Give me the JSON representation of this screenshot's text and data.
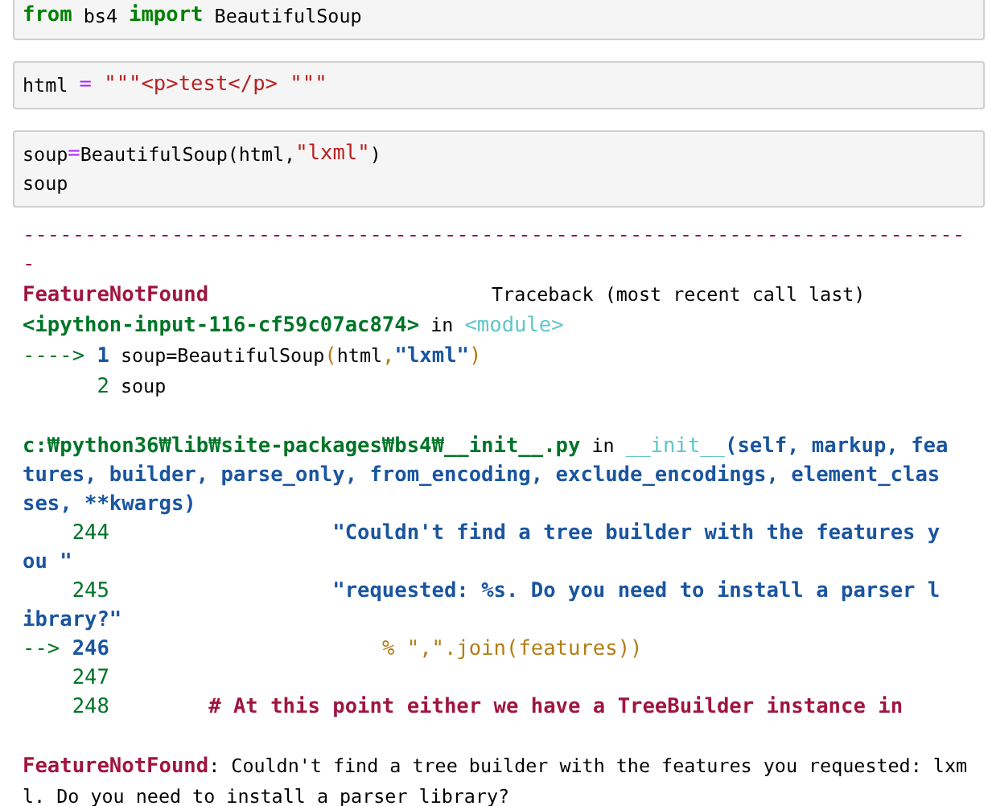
{
  "cells": [
    {
      "lines": [
        [
          {
            "t": "from",
            "kind": "keyword"
          },
          {
            "t": " bs4 ",
            "kind": "text"
          },
          {
            "t": "import",
            "kind": "keyword"
          },
          {
            "t": " BeautifulSoup",
            "kind": "text"
          }
        ]
      ]
    },
    {
      "lines": [
        [
          {
            "t": "html ",
            "kind": "text"
          },
          {
            "t": "=",
            "kind": "operator"
          },
          {
            "t": " \"\"\"<p>test</p> \"\"\"",
            "kind": "string"
          }
        ]
      ]
    },
    {
      "lines": [
        [
          {
            "t": "soup",
            "kind": "text"
          },
          {
            "t": "=",
            "kind": "operator"
          },
          {
            "t": "BeautifulSoup(html,",
            "kind": "text"
          },
          {
            "t": "\"lxml\"",
            "kind": "string"
          },
          {
            "t": ")",
            "kind": "text"
          }
        ],
        [
          {
            "t": "soup",
            "kind": "text"
          }
        ]
      ]
    }
  ],
  "output": {
    "blocks": [
      {
        "lines": [
          {
            "segs": [
              {
                "t": "----------------------------------------------------------------------------",
                "kind": "rule"
              }
            ]
          },
          {
            "segs": [
              {
                "t": "-",
                "kind": "rule"
              }
            ]
          },
          {
            "segs": [
              {
                "t": "FeatureNotFound",
                "kind": "error"
              },
              {
                "t": "                         Traceback (most recent call last)",
                "kind": "text"
              }
            ]
          },
          {
            "segs": [
              {
                "t": "<ipython-input-116-cf59c07ac874>",
                "kind": "location"
              },
              {
                "t": " in ",
                "kind": "text"
              },
              {
                "t": "<module>",
                "kind": "module"
              }
            ]
          },
          {
            "segs": [
              {
                "t": "---->",
                "kind": "arrow"
              },
              {
                "t": " 1",
                "kind": "current"
              },
              {
                "t": " soup=BeautifulSoup",
                "kind": "text"
              },
              {
                "t": "(",
                "kind": "paren"
              },
              {
                "t": "html",
                "kind": "text"
              },
              {
                "t": ",",
                "kind": "paren"
              },
              {
                "t": "\"lxml\"",
                "kind": "source"
              },
              {
                "t": ")",
                "kind": "paren"
              }
            ]
          },
          {
            "segs": [
              {
                "t": "      2",
                "kind": "lineno"
              },
              {
                "t": " soup",
                "kind": "text"
              }
            ]
          }
        ]
      },
      {
        "lines": [
          {
            "segs": [
              {
                "t": "c:₩python36₩lib₩site-packages₩bs4₩__init__.py",
                "kind": "location"
              },
              {
                "t": " in ",
                "kind": "text"
              },
              {
                "t": "__init__",
                "kind": "module"
              },
              {
                "t": "(self, markup, fea",
                "kind": "source"
              }
            ]
          },
          {
            "segs": [
              {
                "t": "tures, builder, parse_only, from_encoding, exclude_encodings, element_clas",
                "kind": "source"
              }
            ]
          },
          {
            "segs": [
              {
                "t": "ses, **kwargs)",
                "kind": "source"
              }
            ]
          },
          {
            "segs": [
              {
                "t": "    244",
                "kind": "lineno"
              },
              {
                "t": "                  \"Couldn't find a tree builder with the features y",
                "kind": "source"
              }
            ]
          },
          {
            "segs": [
              {
                "t": "ou \"",
                "kind": "source"
              }
            ]
          },
          {
            "segs": [
              {
                "t": "    245",
                "kind": "lineno"
              },
              {
                "t": "                  \"requested: %s. Do you need to install a parser l",
                "kind": "source"
              }
            ]
          },
          {
            "segs": [
              {
                "t": "ibrary?\"",
                "kind": "source"
              }
            ]
          },
          {
            "segs": [
              {
                "t": "-->",
                "kind": "arrow"
              },
              {
                "t": " 246",
                "kind": "current"
              },
              {
                "t": "                      % \",\".join(features))",
                "kind": "call"
              }
            ]
          },
          {
            "segs": [
              {
                "t": "    247",
                "kind": "lineno"
              }
            ]
          },
          {
            "segs": [
              {
                "t": "    248",
                "kind": "lineno"
              },
              {
                "t": "        # At this point either we have a TreeBuilder instance in",
                "kind": "comment"
              }
            ]
          }
        ]
      },
      {
        "lines": [
          {
            "segs": [
              {
                "t": "FeatureNotFound",
                "kind": "error"
              },
              {
                "t": ": Couldn't find a tree builder with the features you requested: lxm",
                "kind": "text"
              }
            ]
          },
          {
            "segs": [
              {
                "t": "l. Do you need to install a parser library?",
                "kind": "text"
              }
            ]
          }
        ]
      }
    ]
  }
}
